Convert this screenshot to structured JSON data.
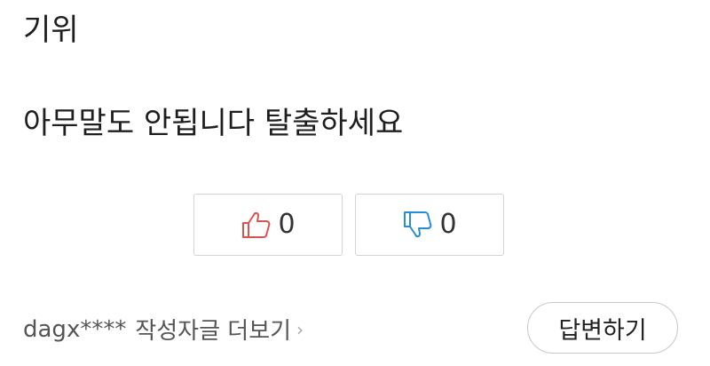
{
  "question": {
    "title": "기위"
  },
  "answer": {
    "text": "아무말도 안됩니다 탈출하세요"
  },
  "votes": {
    "like": {
      "icon": "thumbs-up-icon",
      "color": "#d9534f",
      "count": "0"
    },
    "dislike": {
      "icon": "thumbs-down-icon",
      "color": "#2a8bd6",
      "count": "0"
    }
  },
  "footer": {
    "author_id": "dagx****",
    "more_link": "작성자글 더보기",
    "chevron": "›",
    "reply_label": "답변하기"
  }
}
